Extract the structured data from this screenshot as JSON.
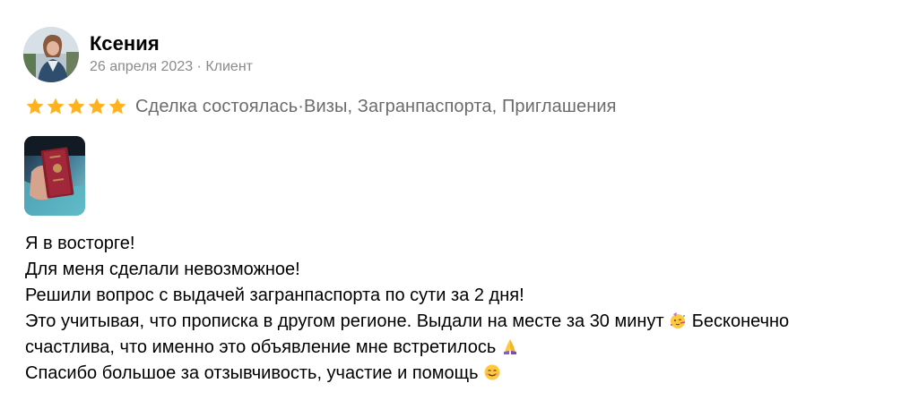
{
  "author": {
    "name": "Ксения",
    "date": "26 апреля 2023",
    "separator": " · ",
    "role": "Клиент"
  },
  "rating": {
    "stars": 5,
    "max": 5,
    "star_color": "#FFB21E"
  },
  "deal": {
    "status": "Сделка состоялась",
    "separator": " · ",
    "category": "Визы, Загранпаспорта, Приглашения"
  },
  "photo": {
    "icon": "passport-photo-thumbnail"
  },
  "review": {
    "line1": "Я в восторге!",
    "line2": "Для меня сделали невозможное!",
    "line3": "Решили вопрос с выдачей загранпаспорта по сути за 2 дня!",
    "line4a": "Это учитывая, что прописка в другом регионе. Выдали на месте за 30 минут ",
    "line4b": " Бесконечно",
    "line5a": "счастлива, что именно это объявление мне встретилось ",
    "line6a": "Спасибо большое за отзывчивость, участие и помощь ",
    "emojis": [
      "partying-face-icon",
      "folded-hands-icon",
      "smiling-face-icon"
    ]
  }
}
